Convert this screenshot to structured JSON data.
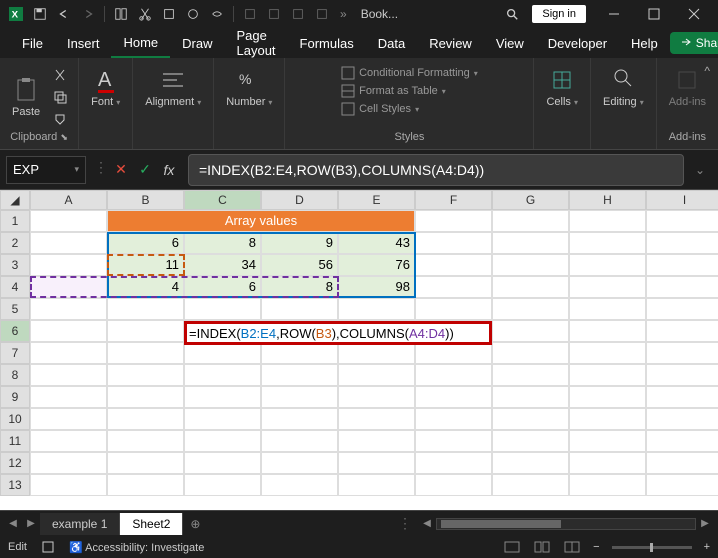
{
  "titlebar": {
    "book": "Book..."
  },
  "signin": "Sign in",
  "menu": {
    "file": "File",
    "insert": "Insert",
    "home": "Home",
    "draw": "Draw",
    "pagelayout": "Page Layout",
    "formulas": "Formulas",
    "data": "Data",
    "review": "Review",
    "view": "View",
    "developer": "Developer",
    "help": "Help",
    "share": "Share"
  },
  "ribbon": {
    "clipboard": "Clipboard",
    "paste": "Paste",
    "font": "Font",
    "alignment": "Alignment",
    "number": "Number",
    "styles": "Styles",
    "condfmt": "Conditional Formatting",
    "fmttable": "Format as Table",
    "cellstyles": "Cell Styles",
    "cells": "Cells",
    "editing": "Editing",
    "addins": "Add-ins"
  },
  "formula": {
    "namebox": "EXP",
    "text": "=INDEX(B2:E4,ROW(B3),COLUMNS(A4:D4))"
  },
  "cols": [
    "A",
    "B",
    "C",
    "D",
    "E",
    "F",
    "G",
    "H",
    "I"
  ],
  "rows": [
    "1",
    "2",
    "3",
    "4",
    "5",
    "6",
    "7",
    "8",
    "9",
    "10",
    "11",
    "12",
    "13"
  ],
  "table": {
    "header": "Array values",
    "r2": {
      "b": "6",
      "c": "8",
      "d": "9",
      "e": "43"
    },
    "r3": {
      "b": "11",
      "c": "34",
      "d": "56",
      "e": "76"
    },
    "r4": {
      "b": "4",
      "c": "6",
      "d": "8",
      "e": "98"
    }
  },
  "cellformula": {
    "prefix": "=INDEX(",
    "r1": "B2:E4",
    "c1": ",ROW(",
    "r2": "B3",
    "c2": "),COLUMNS(",
    "r3": "A4:D4",
    "suffix": "))"
  },
  "sheets": {
    "s1": "example 1",
    "s2": "Sheet2"
  },
  "status": {
    "mode": "Edit",
    "acc": "Accessibility: Investigate"
  }
}
